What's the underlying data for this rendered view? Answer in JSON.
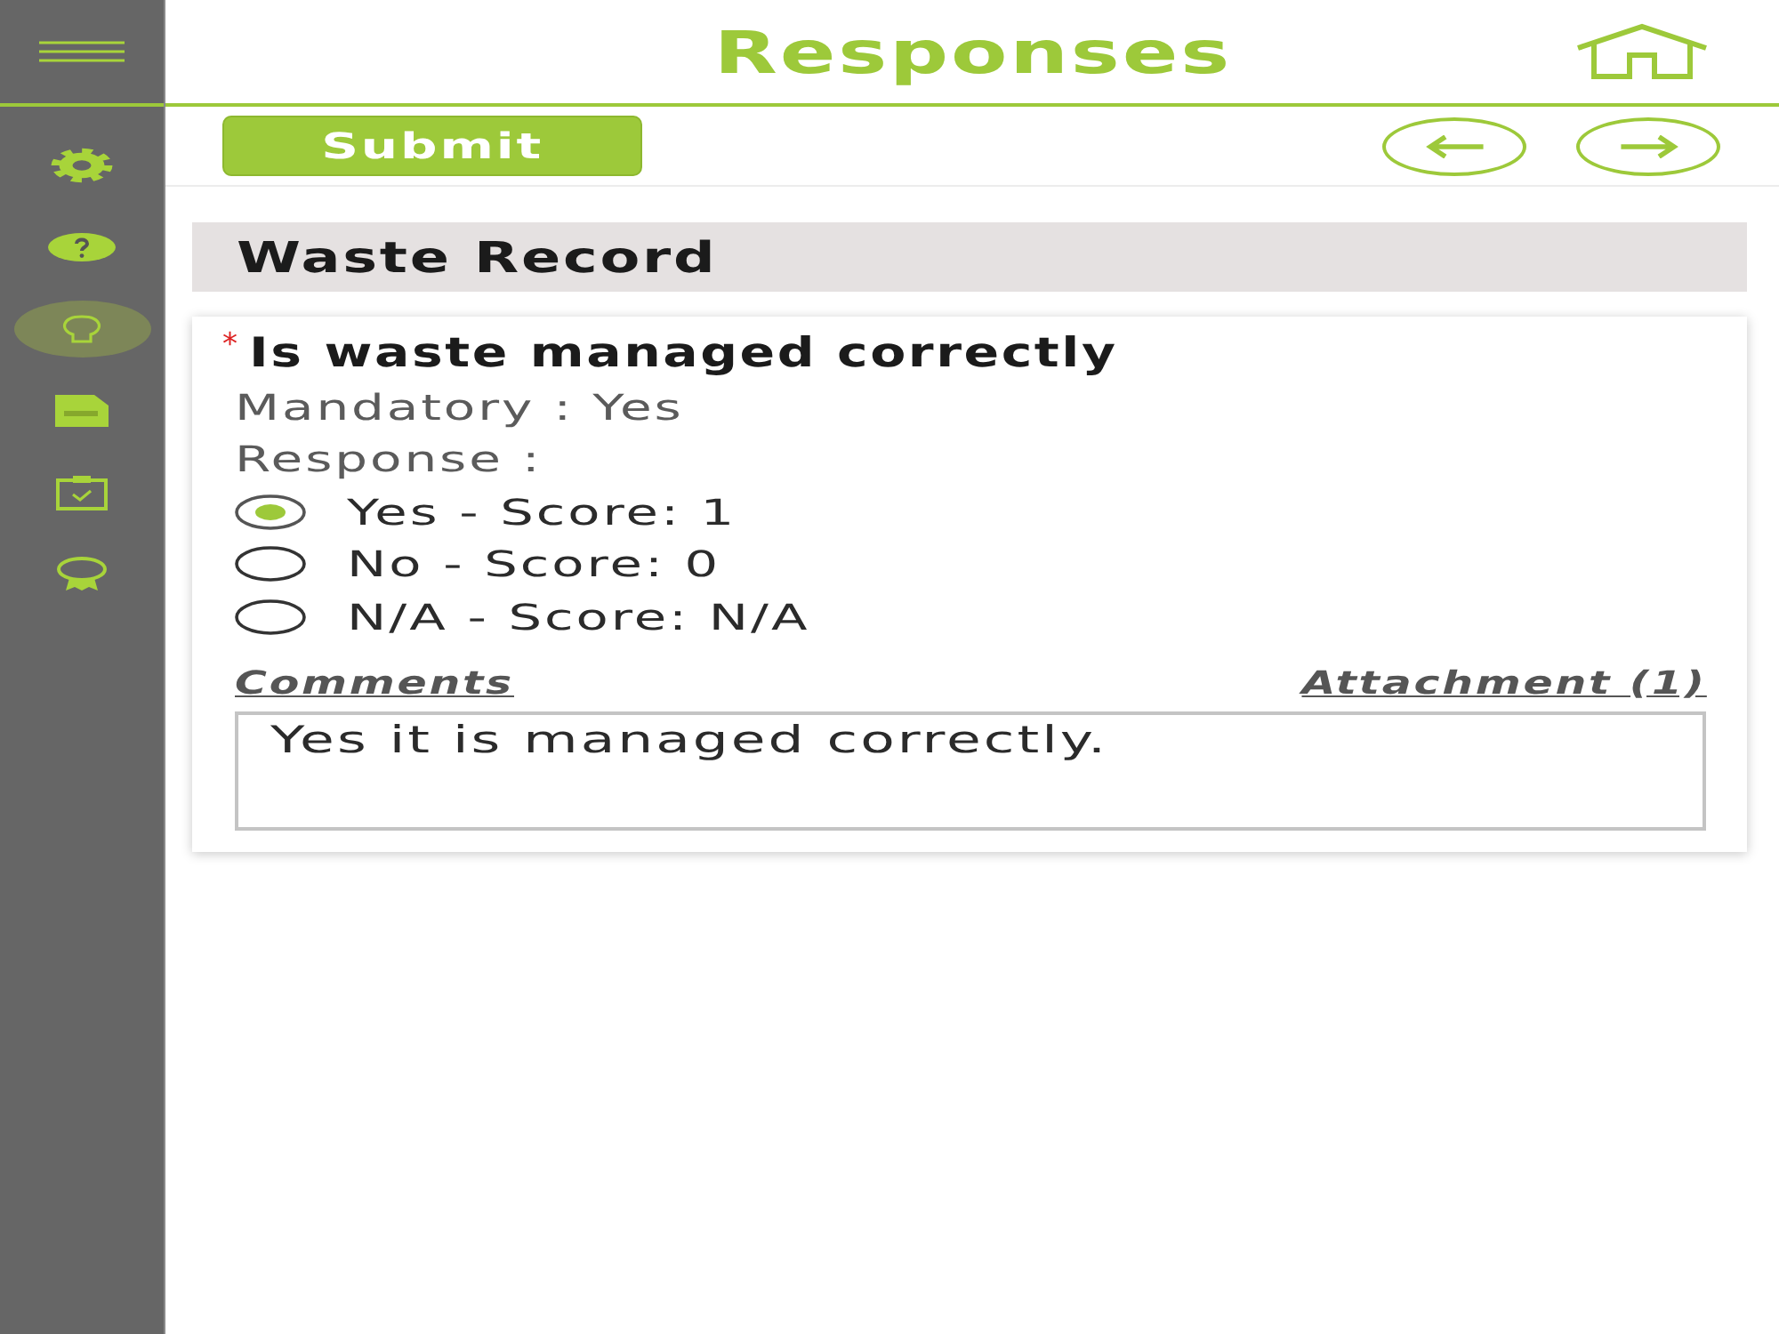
{
  "sidebar": {
    "items": [
      {
        "kind": "settings",
        "selected": false
      },
      {
        "kind": "help",
        "selected": false
      },
      {
        "kind": "idea",
        "selected": true
      },
      {
        "kind": "document",
        "selected": false
      },
      {
        "kind": "checklist",
        "selected": false
      },
      {
        "kind": "award",
        "selected": false
      }
    ]
  },
  "header": {
    "title": "Responses"
  },
  "toolbar": {
    "submit_button": "Submit"
  },
  "section": {
    "title": "Waste Record"
  },
  "question": {
    "required_mark": "*",
    "text": "Is waste managed correctly",
    "mandatory": "Mandatory : Yes",
    "response_label": "Response :",
    "options": [
      {
        "label": "Yes - Score: 1",
        "selected": true
      },
      {
        "label": "No - Score: 0",
        "selected": false
      },
      {
        "label": "N/A - Score: N/A",
        "selected": false
      }
    ],
    "comments_link": "Comments",
    "attachment_link": "Attachment (1)",
    "comment": "Yes it is managed correctly."
  }
}
